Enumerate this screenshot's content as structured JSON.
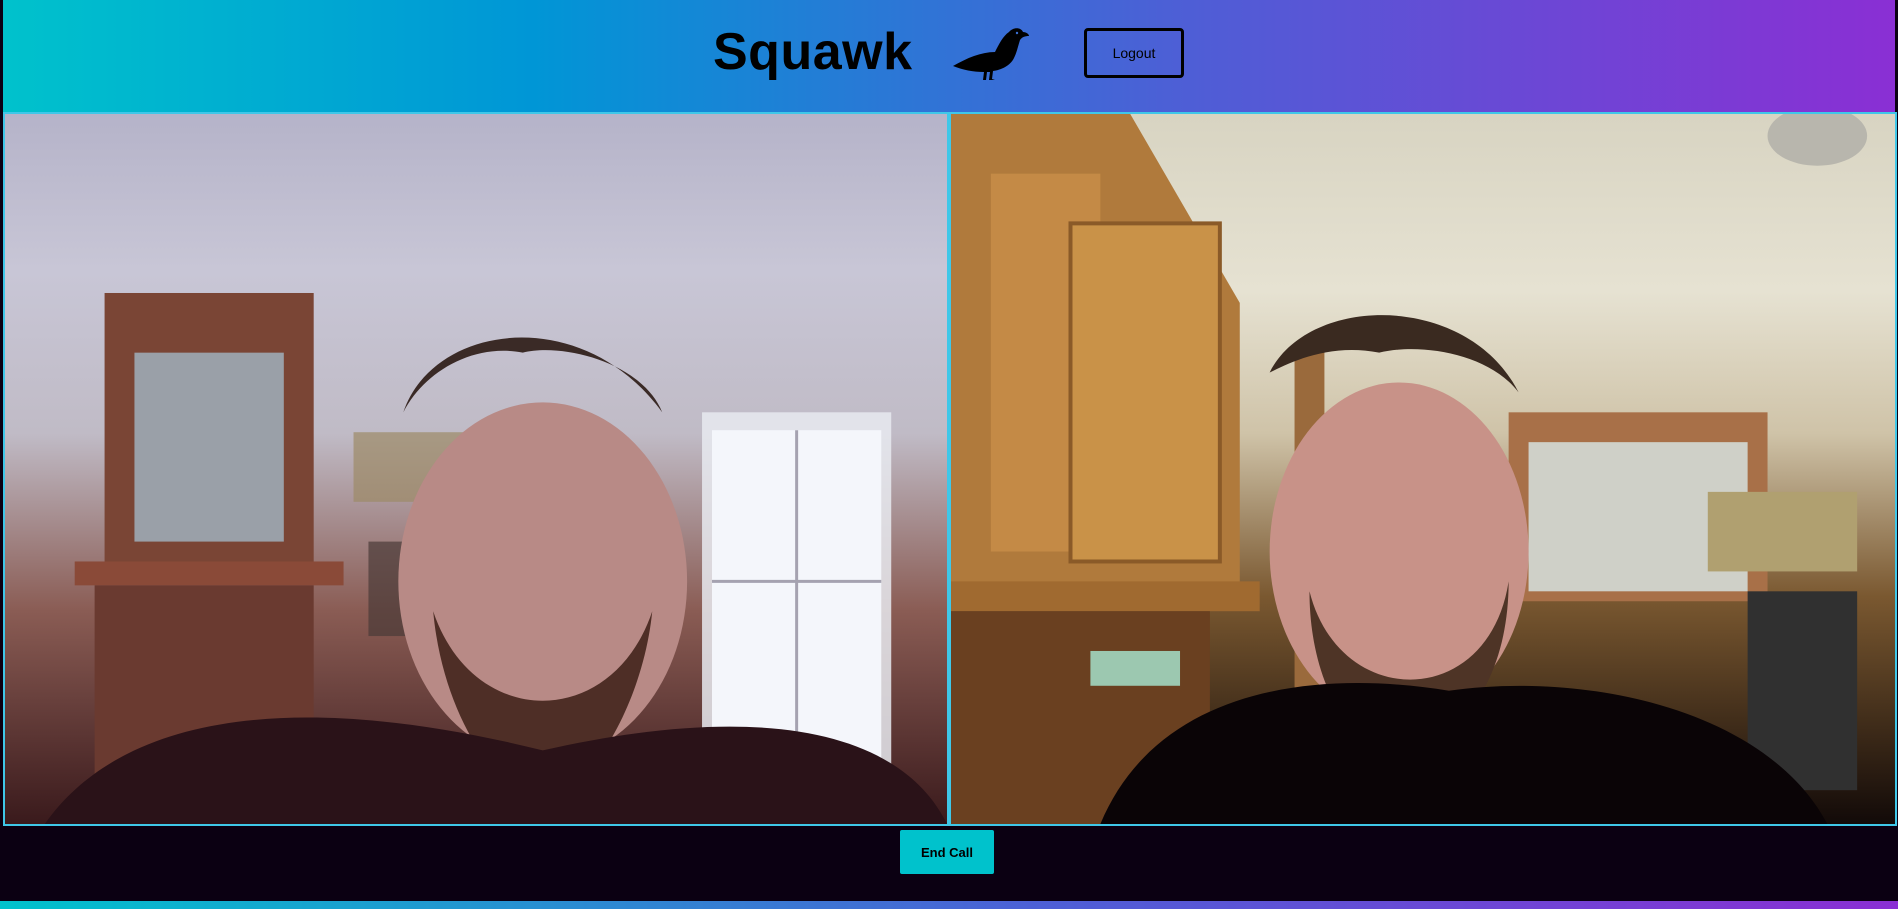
{
  "header": {
    "brand_title": "Squawk",
    "brand_icon": "seagull-icon",
    "logout_label": "Logout"
  },
  "video_call": {
    "tiles": [
      {
        "id": "remote-video"
      },
      {
        "id": "local-video"
      }
    ],
    "end_call_label": "End Call"
  },
  "colors": {
    "gradient_start": "#00c2cc",
    "gradient_mid": "#4d5fd6",
    "gradient_end": "#8a2fd4",
    "video_border": "#3fc7e8",
    "background": "#0b0012",
    "end_call_button": "#00c2cc"
  }
}
